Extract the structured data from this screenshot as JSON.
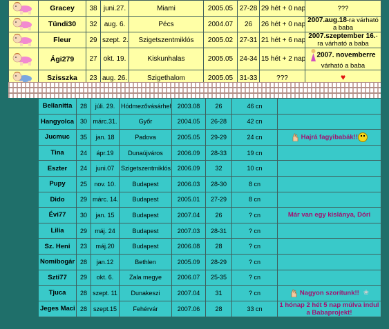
{
  "top_rows": [
    {
      "avatar": "baby-crawling-pink",
      "name": "Gracey",
      "age": "38",
      "date": "juni.27.",
      "city": "Miami",
      "start": "2005.05",
      "cycle": "27-28",
      "week": "29 hét + 0 nap",
      "note": "???"
    },
    {
      "avatar": "baby-crawling-pink",
      "name": "Tündi30",
      "age": "32",
      "date": "aug. 6.",
      "city": "Pécs",
      "start": "2004.07",
      "cycle": "26",
      "week": "26 hét + 0 nap",
      "note_bold": "2007.aug.18",
      "note_rest": "-ra várható a baba"
    },
    {
      "avatar": "baby-crawling-pink",
      "name": "Fleur",
      "age": "29",
      "date": "szept. 2.",
      "city": "Szigetszentmiklós",
      "start": "2005.02",
      "cycle": "27-31",
      "week": "21 hét + 6 nap",
      "note_bold": "2007.szeptember 16.",
      "note_rest": "-ra várható a baba"
    },
    {
      "avatar": "baby-crawling-pink",
      "name": "Ági279",
      "age": "27",
      "date": "okt. 19.",
      "city": "Kiskunhalas",
      "start": "2005.05",
      "cycle": "24-34",
      "week": "15 hét + 2 nap",
      "note_bold": "2007. novemberre",
      "note_rest": " várható a baba"
    },
    {
      "avatar": "baby-crawling-blue",
      "name": "Szisszka",
      "age": "23",
      "date": "aug. 26.",
      "city": "Szigethalom",
      "start": "2005.05",
      "cycle": "31-33",
      "week": "???",
      "note_icon": "heart-icon"
    }
  ],
  "bottom_rows": [
    {
      "name": "Bellanitta",
      "age": "28",
      "date": "júli. 29.",
      "city": "Hódmezővásárhely",
      "start": "2003.08",
      "cycle": "26",
      "length": "46 cn",
      "note": ""
    },
    {
      "name": "Hangyolca",
      "age": "30",
      "date": "márc.31.",
      "city": "Győr",
      "start": "2004.05",
      "cycle": "26-28",
      "length": "42 cn",
      "note": ""
    },
    {
      "name": "Jucmuc",
      "age": "35",
      "date": "jan. 18",
      "city": "Padova",
      "start": "2005.05",
      "cycle": "29-29",
      "length": "24 cn",
      "note": "Hajrá fagyibabák!!",
      "icons": [
        "crossed-fingers-icon",
        "smiley-icon"
      ]
    },
    {
      "name": "Tina",
      "age": "24",
      "date": "ápr.19",
      "city": "Dunaújváros",
      "start": "2006.09",
      "cycle": "28-33",
      "length": "19 cn",
      "note": ""
    },
    {
      "name": "Eszter",
      "age": "24",
      "date": "juni.07",
      "city": "Szigetszentmiklós",
      "start": "2006.09",
      "cycle": "32",
      "length": "10 cn",
      "note": ""
    },
    {
      "name": "Pupy",
      "age": "25",
      "date": "nov. 10.",
      "city": "Budapest",
      "start": "2006.03",
      "cycle": "28-30",
      "length": "8 cn",
      "note": ""
    },
    {
      "name": "Dido",
      "age": "29",
      "date": "márc. 14.",
      "city": "Budapest",
      "start": "2005.01",
      "cycle": "27-29",
      "length": "8 cn",
      "note": ""
    },
    {
      "name": "Évi77",
      "age": "30",
      "date": "jan. 15",
      "city": "Budapest",
      "start": "2007.04",
      "cycle": "26",
      "length": "? cn",
      "note": "Már van egy kislánya, Dóri"
    },
    {
      "name": "Lilia",
      "age": "29",
      "date": "máj. 24",
      "city": "Budapest",
      "start": "2007.03",
      "cycle": "28-31",
      "length": "? cn",
      "note": ""
    },
    {
      "name": "Sz. Heni",
      "age": "23",
      "date": "máj.20",
      "city": "Budapest",
      "start": "2006.08",
      "cycle": "28",
      "length": "? cn",
      "note": ""
    },
    {
      "name": "Nomibogár",
      "age": "28",
      "date": "jan.12",
      "city": "Bethlen",
      "start": "2005.09",
      "cycle": "28-29",
      "length": "? cn",
      "note": ""
    },
    {
      "name": "Szti77",
      "age": "29",
      "date": "okt. 6.",
      "city": "Zala megye",
      "start": "2006.07",
      "cycle": "25-35",
      "length": "? cn",
      "note": ""
    },
    {
      "name": "Tjuca",
      "age": "28",
      "date": "szept. 11",
      "city": "Dunakeszi",
      "start": "2007.04",
      "cycle": "31",
      "length": "? cn",
      "note": "Nagyon szorítunk!!",
      "icons": [
        "crossed-fingers-icon",
        "hug-icon"
      ]
    },
    {
      "name": "Jeges Maci",
      "age": "28",
      "date": "szept.15",
      "city": "Fehérvár",
      "start": "2007.06",
      "cycle": "28",
      "length": "33 cn",
      "note": "1 hónap 2 hét 5 nap múlva indul a Babaprojekt!"
    }
  ]
}
